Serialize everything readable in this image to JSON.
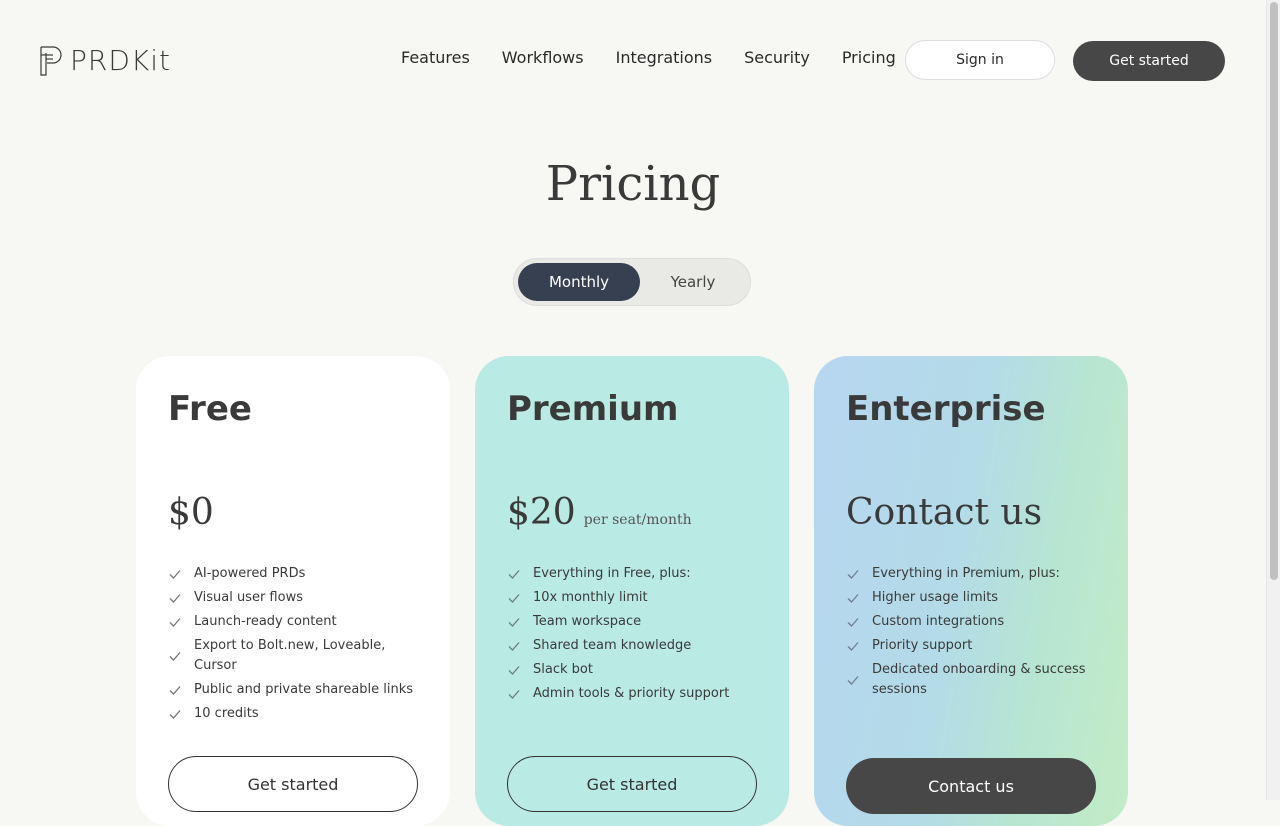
{
  "header": {
    "logo_text": "PRDKit",
    "nav": [
      "Features",
      "Workflows",
      "Integrations",
      "Security",
      "Pricing"
    ],
    "signin_label": "Sign in",
    "getstarted_label": "Get started"
  },
  "page": {
    "title": "Pricing"
  },
  "billing_toggle": {
    "options": [
      "Monthly",
      "Yearly"
    ],
    "selected": "Monthly"
  },
  "plans": [
    {
      "name": "Free",
      "price": "$0",
      "price_unit": "",
      "features": [
        "AI-powered PRDs",
        "Visual user flows",
        "Launch-ready content",
        "Export to Bolt.new, Loveable, Cursor",
        "Public and private shareable links",
        "10 credits"
      ],
      "cta": "Get started"
    },
    {
      "name": "Premium",
      "price": "$20",
      "price_unit": "per seat/month",
      "features": [
        "Everything in Free, plus:",
        "10x monthly limit",
        "Team workspace",
        "Shared team knowledge",
        "Slack bot",
        "Admin tools & priority support"
      ],
      "cta": "Get started"
    },
    {
      "name": "Enterprise",
      "price": "Contact us",
      "price_unit": "",
      "features": [
        "Everything in Premium, plus:",
        "Higher usage limits",
        "Custom integrations",
        "Priority support",
        "Dedicated onboarding & success sessions"
      ],
      "cta": "Contact us"
    }
  ],
  "colors": {
    "background": "#f7f7f3",
    "dark_button": "#474747",
    "toggle_active": "#374050",
    "premium_card": "#b9eae4"
  }
}
